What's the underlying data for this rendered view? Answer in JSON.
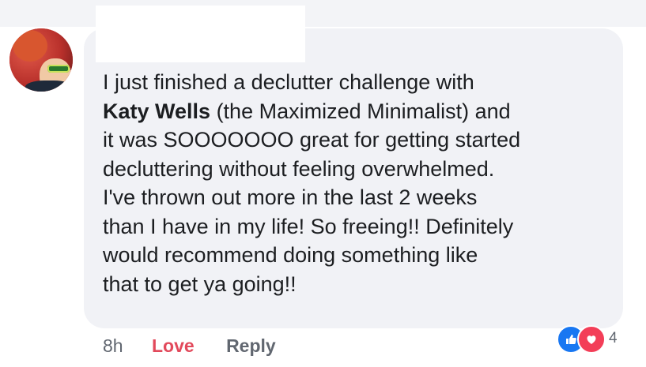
{
  "comment": {
    "lines": [
      {
        "text": "I just finished a declutter challenge with"
      },
      {
        "mention": "Katy Wells",
        "rest": " (the Maximized Minimalist) and"
      },
      {
        "text": "it was SOOOOOOO great for getting started"
      },
      {
        "text": "decluttering without feeling overwhelmed."
      },
      {
        "text": "I've thrown out more in the last 2 weeks"
      },
      {
        "text": "than I have in my life! So freeing!! Definitely"
      },
      {
        "text": "would recommend doing something like"
      },
      {
        "text": "that to get ya going!!"
      }
    ]
  },
  "actions": {
    "timestamp": "8h",
    "love_label": "Love",
    "reply_label": "Reply"
  },
  "reactions": {
    "count": "4",
    "icons": [
      "like-icon",
      "love-icon"
    ]
  },
  "colors": {
    "bubble": "#f1f2f6",
    "text": "#1c1e21",
    "muted": "#616770",
    "love": "#e2495b",
    "like_blue": "#1877f2",
    "love_red": "#f33e58"
  }
}
